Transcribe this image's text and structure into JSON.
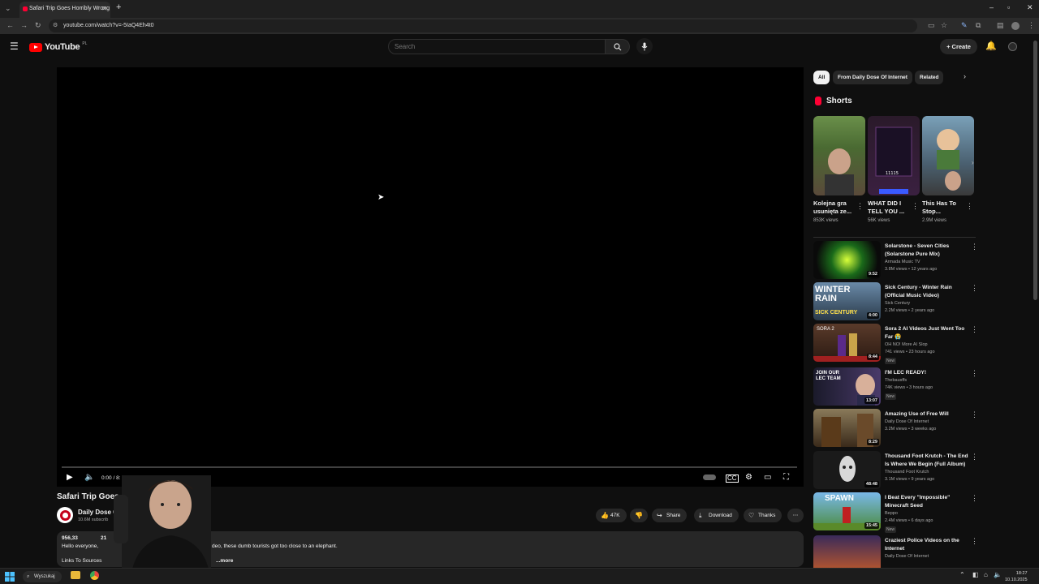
{
  "browser": {
    "tab_title": "Safari Trip Goes Horribly Wrong",
    "url": "youtube.com/watch?v=-5IaQ4Eh4t0"
  },
  "header": {
    "logo_text": "YouTube",
    "country_code": "PL",
    "search_placeholder": "Search",
    "create_label": "Create"
  },
  "player": {
    "time": "0:00 / 8:"
  },
  "video": {
    "title": "Safari Trip Goes",
    "channel_name": "Daily Dose O",
    "channel_subs": "10.6M subscrib",
    "like_count": "47K",
    "share_label": "Share",
    "download_label": "Download",
    "thanks_label": "Thanks",
    "desc_meta": "956,33",
    "desc_meta_tail": "21",
    "desc_line_start": "Hello everyone, ",
    "desc_line_end": "deo, these dumb tourists got too close to an elephant.",
    "desc_links": "Links To Sources",
    "desc_more": "...more"
  },
  "sidebar": {
    "chips": [
      "All",
      "From Daily Dose Of Internet",
      "Related"
    ],
    "shorts_heading": "Shorts",
    "shorts": [
      {
        "title": "Kolejna gra usunięta ze...",
        "views": "853K views"
      },
      {
        "title": "WHAT DID I TELL YOU ...",
        "views": "56K views"
      },
      {
        "title": "This Has To Stop...",
        "views": "2.9M views"
      }
    ],
    "recommended": [
      {
        "title": "Solarstone - Seven Cities (Solarstone Pure Mix)",
        "channel": "Armada Music TV",
        "meta": "3.8M views • 12 years ago",
        "duration": "9:52",
        "badge": ""
      },
      {
        "title": "Sick Century - Winter Rain (Official Music Video)",
        "channel": "Sick Century",
        "meta": "2.2M views • 2 years ago",
        "duration": "4:00",
        "badge": ""
      },
      {
        "title": "Sora 2 AI Videos Just Went Too Far 😭",
        "channel": "OH NO! More AI Slop",
        "meta": "741 views • 23 hours ago",
        "duration": "8:44",
        "badge": "New"
      },
      {
        "title": "I'M LEC READY!",
        "channel": "Thebausffs",
        "meta": "74K views • 3 hours ago",
        "duration": "13:07",
        "badge": "New"
      },
      {
        "title": "Amazing Use of Free Will",
        "channel": "Daily Dose Of Internet",
        "meta": "3.2M views • 3 weeks ago",
        "duration": "8:29",
        "badge": ""
      },
      {
        "title": "Thousand Foot Krutch - The End Is Where We Begin (Full Album)",
        "channel": "Thousand Foot Krutch",
        "meta": "3.1M views • 9 years ago",
        "duration": "48:48",
        "badge": ""
      },
      {
        "title": "I Beat Every \"Impossible\" Minecraft Seed",
        "channel": "Beppo",
        "meta": "2.4M views • 6 days ago",
        "duration": "15:45",
        "badge": "New"
      },
      {
        "title": "Craziest Police Videos on the Internet",
        "channel": "Daily Dose Of Internet",
        "meta": "",
        "duration": "",
        "badge": ""
      }
    ],
    "thumb_texts": {
      "winter": "WINTER RAIN",
      "sick": "SICK CENTURY",
      "sora": "SORA 2",
      "lec": "JOIN OUR LEC TEAM",
      "spawn": "SPAWN"
    }
  },
  "taskbar": {
    "search_label": "Wyszukaj",
    "time": "18:27",
    "date": "10.10.2025"
  },
  "colors": {
    "bg": "#0f0f0f",
    "brand_red": "#ff0000",
    "chip_bg": "#272727"
  }
}
